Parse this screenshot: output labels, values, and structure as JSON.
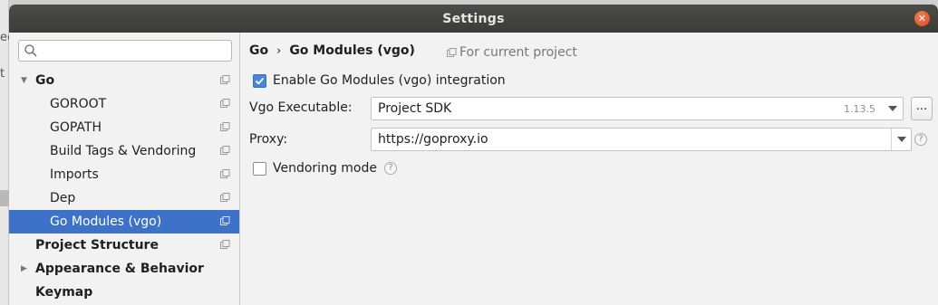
{
  "background": {
    "fragments": [
      "ec",
      "t"
    ]
  },
  "window": {
    "title": "Settings"
  },
  "sidebar": {
    "search": {
      "placeholder": "",
      "value": ""
    },
    "items": [
      {
        "label": "Go",
        "bold": true,
        "expanded": true,
        "level": 0,
        "has_project_icon": true
      },
      {
        "label": "GOROOT",
        "bold": false,
        "level": 1,
        "has_project_icon": true
      },
      {
        "label": "GOPATH",
        "bold": false,
        "level": 1,
        "has_project_icon": true
      },
      {
        "label": "Build Tags & Vendoring",
        "bold": false,
        "level": 1,
        "has_project_icon": true
      },
      {
        "label": "Imports",
        "bold": false,
        "level": 1,
        "has_project_icon": true
      },
      {
        "label": "Dep",
        "bold": false,
        "level": 1,
        "has_project_icon": true
      },
      {
        "label": "Go Modules (vgo)",
        "bold": false,
        "level": 1,
        "has_project_icon": true,
        "selected": true
      },
      {
        "label": "Project Structure",
        "bold": true,
        "level": 0,
        "has_project_icon": true
      },
      {
        "label": "Appearance & Behavior",
        "bold": true,
        "level": 0,
        "collapsed": true
      },
      {
        "label": "Keymap",
        "bold": true,
        "level": 0
      }
    ]
  },
  "main": {
    "breadcrumb": {
      "parent": "Go",
      "separator": "›",
      "current": "Go Modules (vgo)"
    },
    "scope_note": "For current project",
    "enable_checkbox": {
      "label": "Enable Go Modules (vgo) integration",
      "checked": true
    },
    "vgo_executable": {
      "label": "Vgo Executable:",
      "value": "Project SDK",
      "version": "1.13.5",
      "browse_label": "..."
    },
    "proxy": {
      "label": "Proxy:",
      "value": "https://goproxy.io"
    },
    "vendoring_checkbox": {
      "label": "Vendoring mode",
      "checked": false,
      "help": "?"
    }
  },
  "colors": {
    "accent": "#3d72c8",
    "titlebar": "#3f3f3c",
    "close": "#e5582a",
    "checkbox": "#4a86d4"
  }
}
